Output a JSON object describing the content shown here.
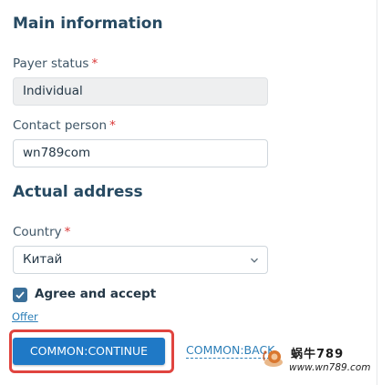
{
  "sections": {
    "main_title": "Main information",
    "address_title": "Actual address"
  },
  "fields": {
    "payer_status": {
      "label": "Payer status",
      "required_mark": "*",
      "value": "Individual"
    },
    "contact_person": {
      "label": "Contact person",
      "required_mark": "*",
      "value": "wn789com"
    },
    "country": {
      "label": "Country",
      "required_mark": "*",
      "value": "Китай"
    }
  },
  "agreement": {
    "checked": true,
    "label": "Agree and accept",
    "offer_link": "Offer"
  },
  "actions": {
    "continue_label": "COMMON:CONTINUE",
    "back_label": "COMMON:BACK"
  },
  "watermark": {
    "title": "蜗牛789",
    "url": "www.wn789.com"
  },
  "colors": {
    "primary_button": "#1f79c6",
    "link": "#2d7fb8",
    "highlight_border": "#e0443f",
    "checkbox": "#3a6f99",
    "required": "#d93636"
  },
  "icons": {
    "select_chevron": "chevron-down-icon",
    "checkbox": "checkmark-icon",
    "watermark_logo": "snail-logo-icon"
  }
}
